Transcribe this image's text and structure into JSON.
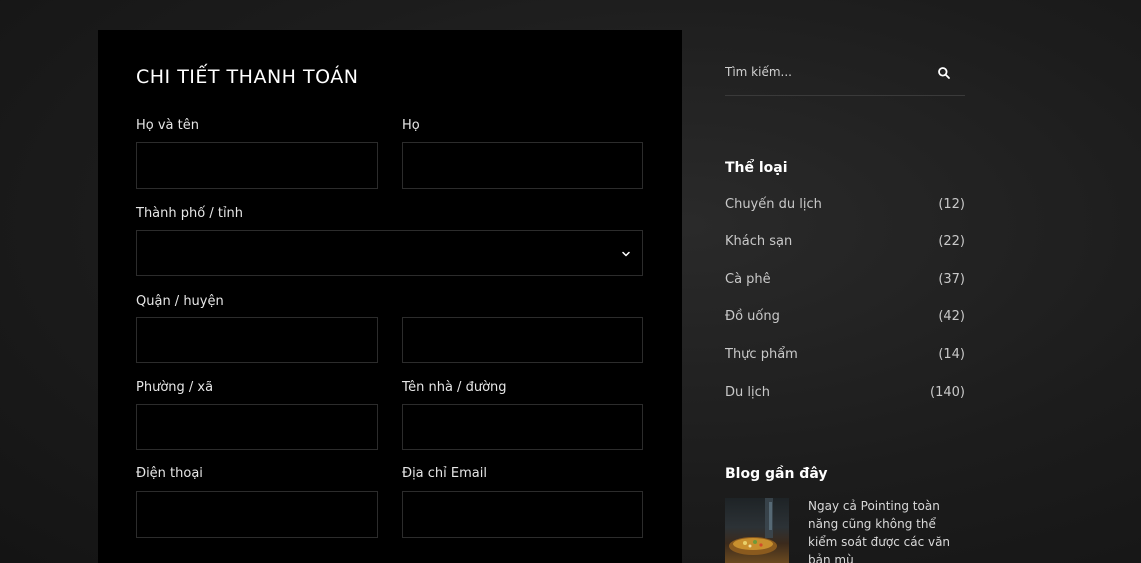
{
  "billing": {
    "title": "CHI TIẾT THANH TOÁN",
    "first_name_label": "Họ và tên",
    "last_name_label": "Họ",
    "city_label": "Thành phố / tỉnh",
    "district_label": "Quận / huyện",
    "ward_label": "Phường / xã",
    "street_label": "Tên nhà / đường",
    "phone_label": "Điện thoại",
    "email_label": "Địa chỉ Email",
    "city_selected": ""
  },
  "sidebar": {
    "search_placeholder": "Tìm kiếm...",
    "categories_heading": "Thể loại",
    "categories": [
      {
        "label": "Chuyến du lịch",
        "count": "(12)"
      },
      {
        "label": "Khách sạn",
        "count": "(22)"
      },
      {
        "label": "Cà phê",
        "count": "(37)"
      },
      {
        "label": "Đồ uống",
        "count": "(42)"
      },
      {
        "label": "Thực phẩm",
        "count": "(14)"
      },
      {
        "label": "Du lịch",
        "count": "(140)"
      }
    ],
    "recent_heading": "Blog gần đây",
    "recent_posts": [
      {
        "title": "Ngay cả Pointing toàn năng cũng không thể kiểm soát được các văn bản mù"
      }
    ]
  },
  "icons": {
    "search": "search-icon",
    "select_arrow": "chevron-down-icon"
  }
}
